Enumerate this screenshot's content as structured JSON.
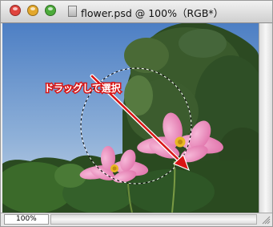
{
  "window": {
    "title": "flower.psd @ 100%（RGB*）",
    "traffic_lights": {
      "close": "#e0443e",
      "minimize": "#e3a72b",
      "zoom": "#4cab3a"
    }
  },
  "canvas": {
    "annotation_label": "ドラッグして選択",
    "annotation_color": "#d81414"
  },
  "status": {
    "zoom_value": "100%"
  }
}
